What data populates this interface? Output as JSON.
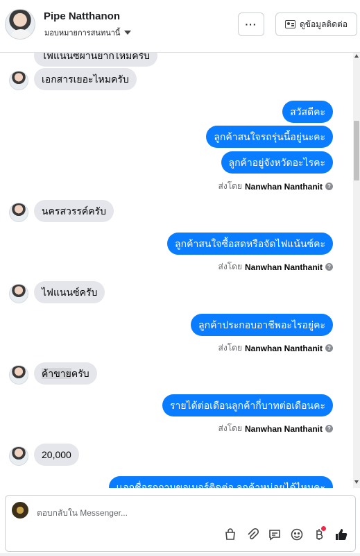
{
  "header": {
    "name": "Pipe Natthanon",
    "assign_label": "มอบหมายการสนทนานี้",
    "more_label": "···",
    "contact_label": "ดูข้อมูลติดต่อ"
  },
  "messages": {
    "m0": "ไฟแนนซ์ผ่านยากไหมครับ",
    "m1": "เอกสารเยอะไหมครับ",
    "m2": "สวัสดีคะ",
    "m3": "ลูกค้าสนใจรถรุ่นนี้อยู่นะคะ",
    "m4": "ลูกค้าอยู่จังหวัดอะไรคะ",
    "m5": "นครสวรรค์ครับ",
    "m6": "ลูกค้าสนใจซื้อสดหรือจัดไฟแน้นซ์คะ",
    "m7": "ไฟแนนซ์ครับ",
    "m8": "ลูกค้าประกอบอาชีพอะไรอยู่คะ",
    "m9a": "ค้าขาย",
    "m9b": "ครับ",
    "m10": "รายได้ต่อเดือนลูกค้ากี่บาทต่อเดือนคะ",
    "m11": "20,000",
    "m12": "เเอกชื่อรถถามขอเบอร์ติดต่อ ลูกค้าหน่อยได้ไหมคะ"
  },
  "sent_by": {
    "prefix": "ส่งโดย",
    "agent": "Nanwhan Nanthanit",
    "help": "?"
  },
  "composer": {
    "placeholder": "ตอบกลับใน Messenger..."
  },
  "icons": [
    "shopping-bag-icon",
    "attachment-icon",
    "saved-reply-icon",
    "emoji-icon",
    "baht-icon",
    "thumbs-up-icon"
  ],
  "colors": {
    "outgoing": "#0a7cff",
    "incoming": "#e4e6eb",
    "like": "#1c1e21"
  }
}
